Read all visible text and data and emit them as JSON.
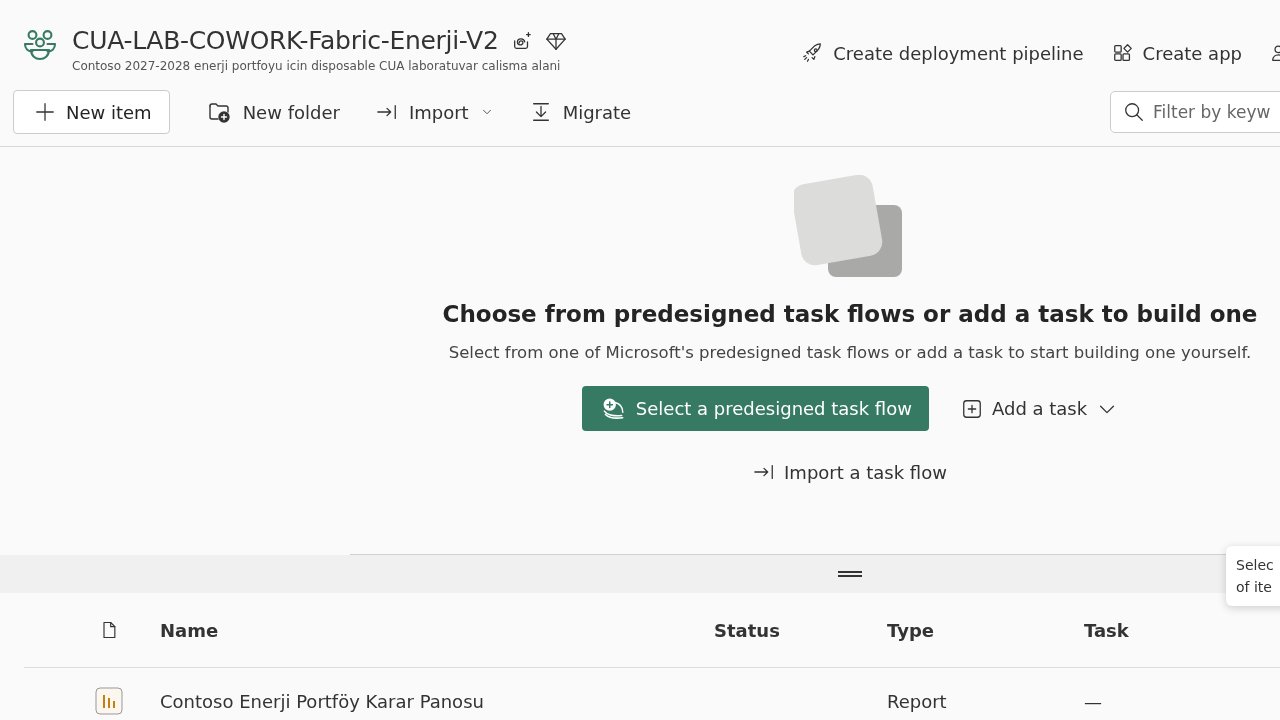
{
  "workspace": {
    "title": "CUA-LAB-COWORK-Fabric-Enerji-V2",
    "description": "Contoso 2027-2028 enerji portfoyu icin disposable CUA laboratuvar calisma alani"
  },
  "header_actions": [
    {
      "kind": "pipeline",
      "label": "Create deployment pipeline"
    },
    {
      "kind": "app",
      "label": "Create app"
    },
    {
      "kind": "people"
    }
  ],
  "toolbar": [
    {
      "kind": "new-item",
      "label": "New item"
    },
    {
      "kind": "new-folder",
      "label": "New folder"
    },
    {
      "kind": "import",
      "label": "Import"
    },
    {
      "kind": "migrate",
      "label": "Migrate"
    }
  ],
  "filter": {
    "placeholder": "Filter by keyw"
  },
  "task_flow": {
    "heading": "Choose from predesigned task flows or add a task to build one",
    "subtext": "Select from one of Microsoft's predesigned task flows or add a task to start building one yourself.",
    "primary_button": "Select a predesigned task flow",
    "add_task": "Add a task",
    "import_flow": "Import a task flow"
  },
  "tooltip": [
    "Selec",
    "of ite"
  ],
  "table": {
    "columns": [
      "Name",
      "Status",
      "Type",
      "Task"
    ],
    "rows": [
      {
        "name": "Contoso Enerji Portföy Karar Panosu",
        "status": "",
        "type": "Report",
        "task": "—"
      }
    ]
  }
}
